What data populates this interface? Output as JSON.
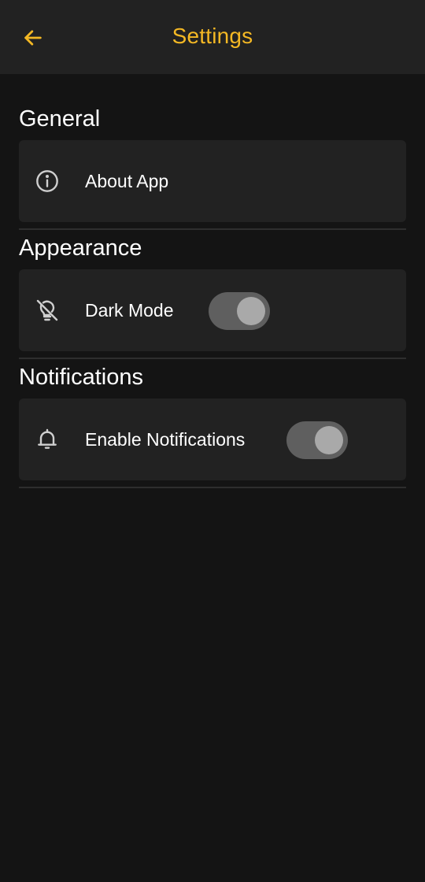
{
  "header": {
    "title": "Settings",
    "back_icon": "arrow-left-icon",
    "accent_color": "#F4B824"
  },
  "sections": [
    {
      "title": "General",
      "items": [
        {
          "label": "About App",
          "icon": "info-icon"
        }
      ]
    },
    {
      "title": "Appearance",
      "items": [
        {
          "label": "Dark Mode",
          "icon": "lightbulb-off-icon",
          "toggle": true
        }
      ]
    },
    {
      "title": "Notifications",
      "items": [
        {
          "label": "Enable Notifications",
          "icon": "bell-icon",
          "toggle": true
        }
      ]
    }
  ],
  "colors": {
    "background": "#141414",
    "surface": "#222222",
    "text": "#FFFFFF",
    "icon": "#CFCFCF",
    "toggle_track": "#5F5F5F",
    "toggle_knob": "#A9A9A9"
  }
}
